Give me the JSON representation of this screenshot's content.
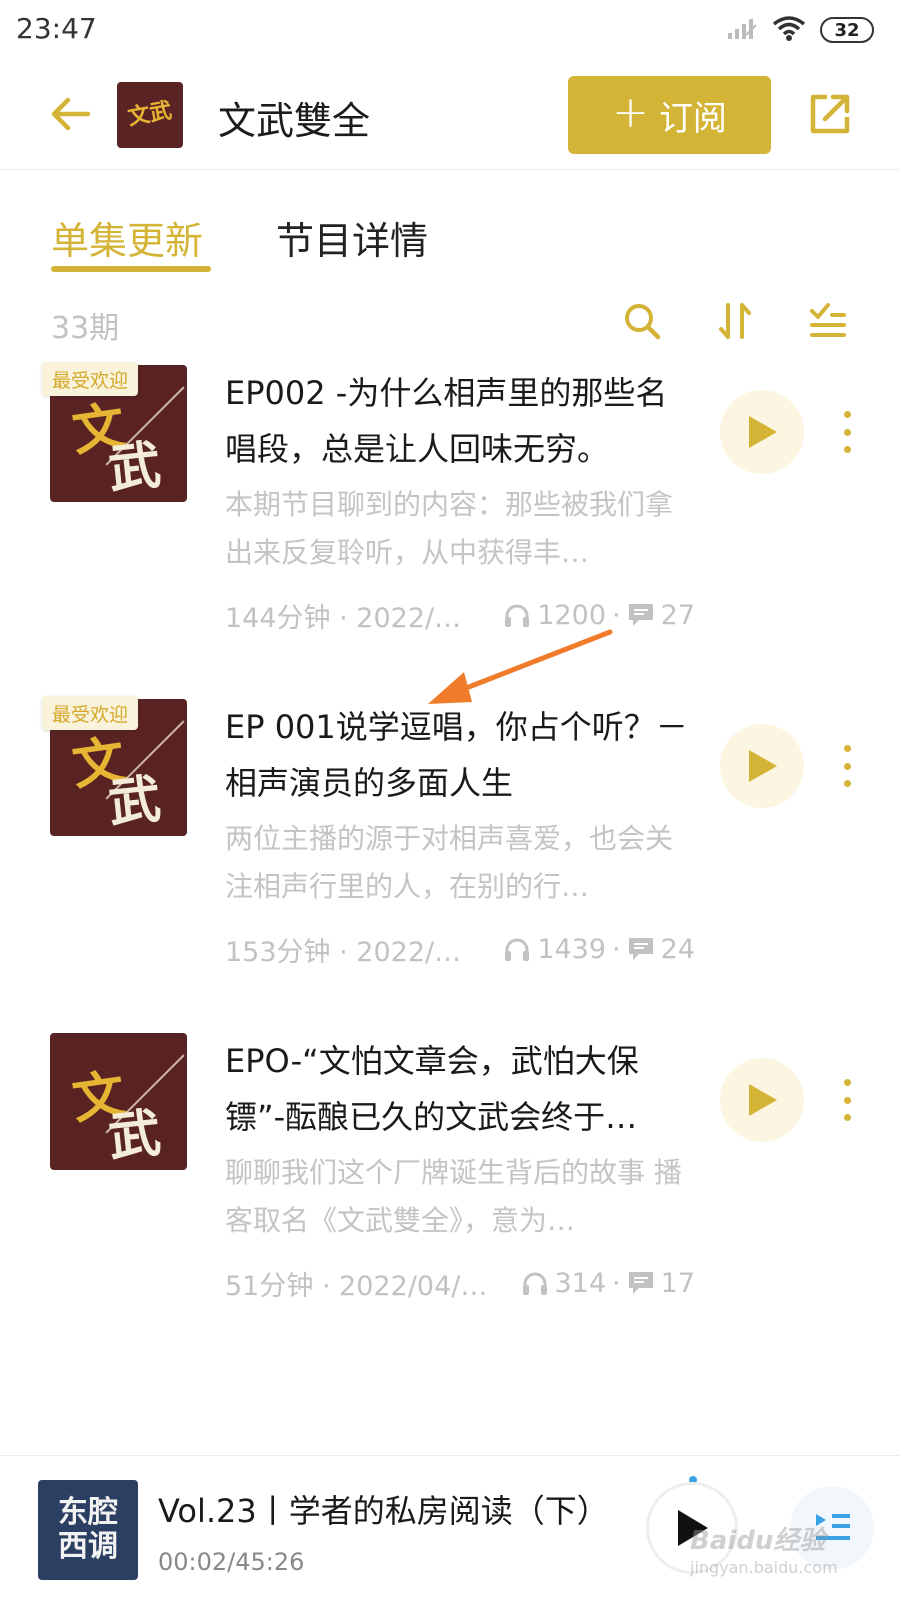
{
  "status_bar": {
    "time": "23:47",
    "battery": "32"
  },
  "header": {
    "title": "文武雙全",
    "cover_text": "文武",
    "subscribe_plus": "+",
    "subscribe_label": "订阅",
    "accent_color": "#d4b437"
  },
  "tabs": [
    {
      "label": "单集更新",
      "active": true
    },
    {
      "label": "节目详情",
      "active": false
    }
  ],
  "list_toolbar": {
    "episode_count": "33期"
  },
  "episodes": [
    {
      "badge": "最受欢迎",
      "cover_char_1": "文",
      "cover_char_2": "武",
      "title": "EP002 -为什么相声里的那些名唱段，总是让人回味无穷。",
      "description": "本期节目聊到的内容：那些被我们拿出来反复聆听，从中获得丰…",
      "duration_date": "144分钟 · 2022/…",
      "plays": "1200",
      "separator": "·",
      "comments": "27"
    },
    {
      "badge": "最受欢迎",
      "cover_char_1": "文",
      "cover_char_2": "武",
      "title": "EP 001说学逗唱，你占个听？－相声演员的多面人生",
      "description": "两位主播的源于对相声喜爱，也会关注相声行里的人，在别的行…",
      "duration_date": "153分钟 · 2022/…",
      "plays": "1439",
      "separator": "·",
      "comments": "24"
    },
    {
      "badge": "",
      "cover_char_1": "文",
      "cover_char_2": "武",
      "title": " EPO-“文怕文章会，武怕大保镖”-酝酿已久的文武会终于…",
      "description": "聊聊我们这个厂牌诞生背后的故事 播客取名《文武雙全》，意为…",
      "duration_date": "51分钟 · 2022/04/…",
      "plays": "314",
      "separator": "·",
      "comments": "17"
    }
  ],
  "mini_player": {
    "cover_line_1": "东腔",
    "cover_line_2": "西调",
    "title": "Vol.23丨学者的私房阅读（下）",
    "time": "00:02/45:26",
    "progress_fraction": 0.001
  },
  "watermark": {
    "text": "Baidu经验",
    "sub": "jingyan.baidu.com"
  }
}
